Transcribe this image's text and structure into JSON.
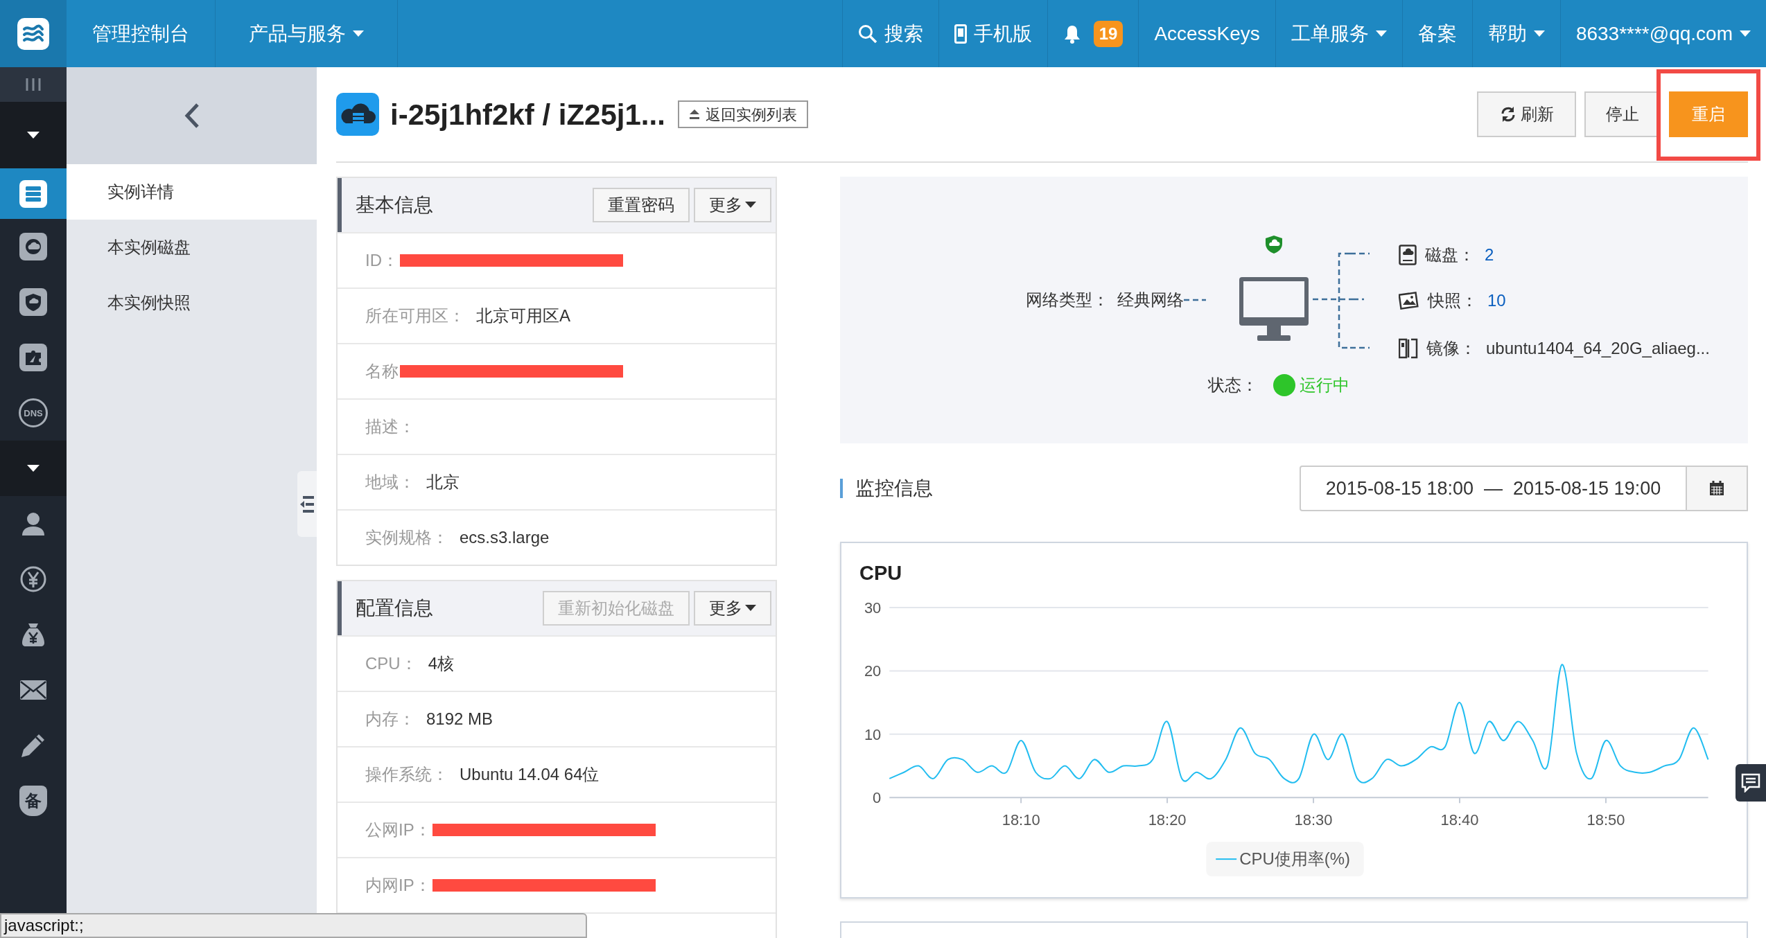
{
  "top_nav": {
    "left_items": [
      {
        "kind": "text",
        "label": "管理控制台"
      },
      {
        "kind": "dropdown",
        "label": "产品与服务"
      }
    ],
    "right_items": [
      {
        "kind": "search",
        "label": "搜索"
      },
      {
        "kind": "mobile",
        "label": "手机版"
      },
      {
        "kind": "bell",
        "badge": "19"
      },
      {
        "kind": "text",
        "label": "AccessKeys"
      },
      {
        "kind": "dropdown",
        "label": "工单服务"
      },
      {
        "kind": "text",
        "label": "备案"
      },
      {
        "kind": "dropdown",
        "label": "帮助"
      },
      {
        "kind": "dropdown",
        "label": "8633****@qq.com"
      }
    ]
  },
  "icon_rail": [
    {
      "kind": "toggle"
    },
    {
      "kind": "caret"
    },
    {
      "kind": "server",
      "selected": true
    },
    {
      "kind": "disk",
      "selected": false
    },
    {
      "kind": "shield",
      "selected": false
    },
    {
      "kind": "puzzle",
      "selected": false
    },
    {
      "kind": "dns",
      "text": "DNS",
      "selected": false
    },
    {
      "kind": "caret"
    },
    {
      "kind": "user",
      "selected": false
    },
    {
      "kind": "yen",
      "selected": false
    },
    {
      "kind": "bag",
      "selected": false
    },
    {
      "kind": "mail",
      "selected": false
    },
    {
      "kind": "pencil",
      "selected": false
    },
    {
      "kind": "badge",
      "text": "备",
      "selected": false
    }
  ],
  "sub_nav": {
    "items": [
      {
        "label": "实例详情",
        "selected": true
      },
      {
        "label": "本实例磁盘",
        "selected": false
      },
      {
        "label": "本实例快照",
        "selected": false
      }
    ]
  },
  "header": {
    "title": "i-25j1hf2kf / iZ25j1...",
    "back_button": "返回实例列表",
    "actions": [
      {
        "kind": "refresh",
        "label": "刷新",
        "highlighted": false
      },
      {
        "kind": "plain",
        "label": "停止",
        "highlighted": false
      },
      {
        "kind": "primary",
        "label": "重启",
        "highlighted": true
      }
    ]
  },
  "sections": [
    {
      "title": "基本信息",
      "buttons": [
        {
          "label": "重置密码",
          "kind": "plain",
          "disabled": false
        },
        {
          "label": "更多",
          "kind": "dropdown",
          "disabled": false
        }
      ],
      "rows": [
        {
          "label": "ID：",
          "redacted": true
        },
        {
          "label": "所在可用区：",
          "value": "北京可用区A",
          "redacted": false
        },
        {
          "label": "名称",
          "redacted": true
        },
        {
          "label": "描述：",
          "redacted": false
        },
        {
          "label": "地域：",
          "value": "北京",
          "redacted": false
        },
        {
          "label": "实例规格：",
          "value": "ecs.s3.large",
          "redacted": false
        }
      ]
    },
    {
      "title": "配置信息",
      "buttons": [
        {
          "label": "重新初始化磁盘",
          "kind": "plain",
          "disabled": true
        },
        {
          "label": "更多",
          "kind": "dropdown",
          "disabled": false
        }
      ],
      "rows": [
        {
          "label": "CPU：",
          "value": "4核",
          "redacted": false
        },
        {
          "label": "内存：",
          "value": "8192 MB",
          "redacted": false
        },
        {
          "label": "操作系统：",
          "value": "Ubuntu 14.04 64位",
          "redacted": false
        },
        {
          "label": "公网IP：",
          "redacted": true
        },
        {
          "label": "内网IP：",
          "redacted": true
        }
      ]
    }
  ],
  "diagram": {
    "network_label": "网络类型：",
    "network_value": "经典网络",
    "resources": [
      {
        "kind": "disk",
        "label": "磁盘：",
        "value": "2",
        "link": true
      },
      {
        "kind": "snapshot",
        "label": "快照：",
        "value": "10",
        "link": true
      },
      {
        "kind": "image",
        "label": "镜像：",
        "value": "ubuntu1404_64_20G_aliaeg...",
        "link": false
      }
    ],
    "status": {
      "label": "状态：",
      "value": "运行中",
      "color": "#2ec52a"
    }
  },
  "monitoring": {
    "title": "监控信息",
    "start": "2015-08-15 18:00",
    "separator": "—",
    "end": "2015-08-15 19:00"
  },
  "charts": [
    {
      "title": "CPU",
      "chart_data": {
        "type": "line",
        "categories": [
          null,
          null,
          null,
          null,
          null,
          null,
          null,
          null,
          null,
          "18:10",
          null,
          null,
          null,
          null,
          null,
          null,
          null,
          null,
          null,
          "18:20",
          null,
          null,
          null,
          null,
          null,
          null,
          null,
          null,
          null,
          "18:30",
          null,
          null,
          null,
          null,
          null,
          null,
          null,
          null,
          null,
          "18:40",
          null,
          null,
          null,
          null,
          null,
          null,
          null,
          null,
          null,
          "18:50",
          null,
          null,
          null,
          null,
          null,
          null,
          null
        ],
        "series": [
          {
            "name": "CPU使用率(%)",
            "color": "#22bdf0",
            "values": [
              3,
              4,
              5,
              3,
              6,
              6,
              4,
              5,
              4,
              9,
              4,
              3,
              5,
              3,
              6,
              4,
              5,
              5,
              6,
              12,
              3,
              4,
              3,
              6,
              11,
              7,
              6,
              3,
              3,
              10,
              6,
              10,
              3,
              3,
              6,
              5,
              6,
              8,
              8,
              15,
              7,
              12,
              9,
              12,
              9,
              5,
              21,
              7,
              3,
              9,
              5,
              4,
              4,
              5,
              6,
              11,
              6
            ]
          }
        ],
        "ylim": [
          0,
          30
        ],
        "yticks": [
          0,
          10,
          20,
          30
        ]
      }
    }
  ],
  "status_bar": "javascript:;"
}
